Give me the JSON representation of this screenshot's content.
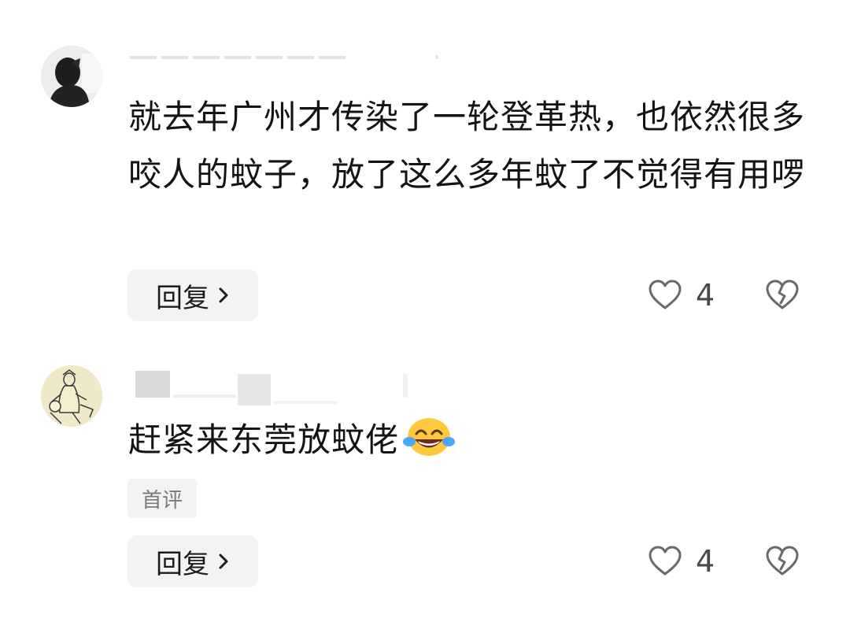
{
  "comments": [
    {
      "text": "就去年广州才传染了一轮登革热，也依然很多咬人的蚊子，放了这么多年蚊了不觉得有用啰",
      "reply_label": "回复",
      "like_count": "4"
    },
    {
      "text": "赶紧来东莞放蚊佬",
      "emoji": "face-with-tears-of-joy",
      "badge": "首评",
      "reply_label": "回复",
      "like_count": "4"
    }
  ],
  "colors": {
    "background": "#ffffff",
    "pill": "#f3f3f3",
    "icon_stroke": "#6a6a6a",
    "count_text": "#4a4a4a"
  }
}
